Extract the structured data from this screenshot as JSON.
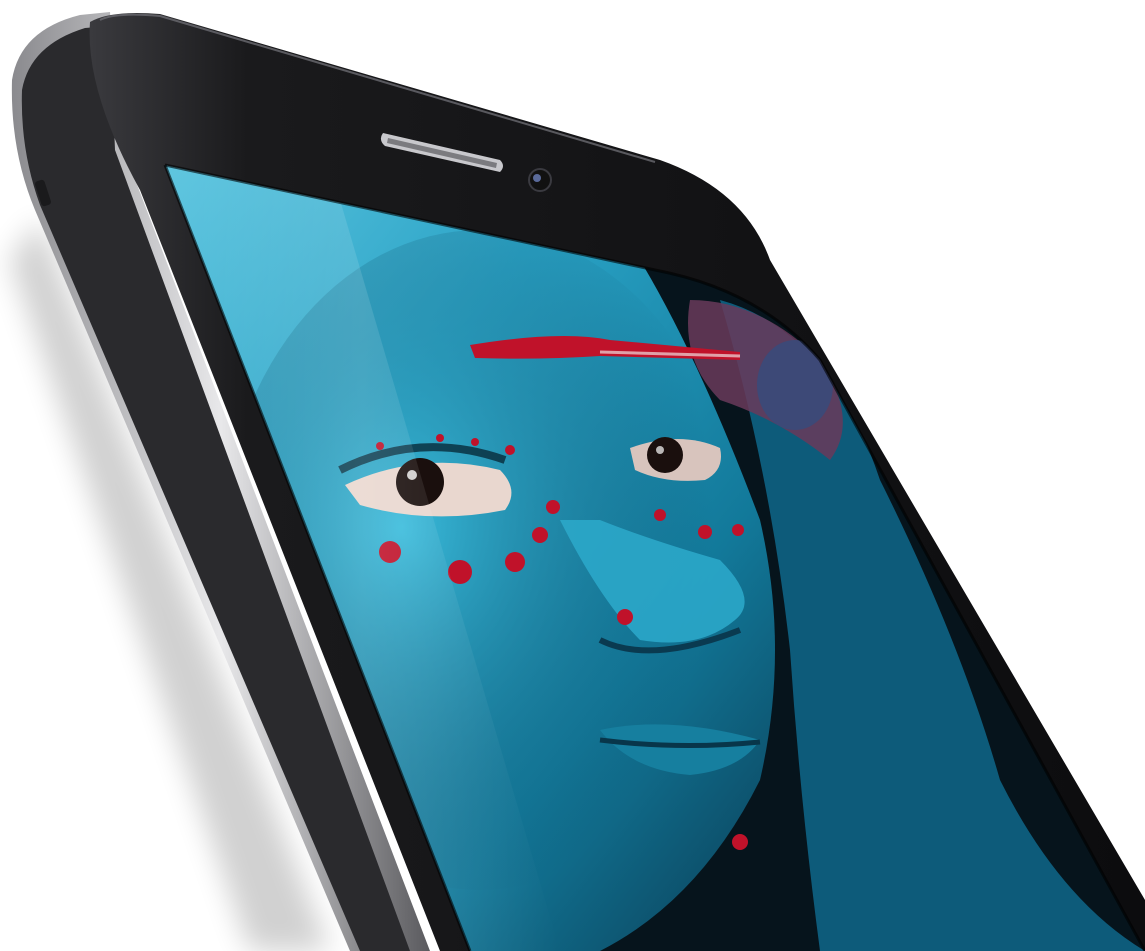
{
  "scene": {
    "subject": "smartphone",
    "background_color": "#ffffff",
    "colors": {
      "frame_dark": "#1c1c1e",
      "frame_edge": "#5a5a5e",
      "bezel": "#0e0e10",
      "face_paint_blue": "#1b8fb0",
      "face_paint_cyan": "#29b5d6",
      "paint_red": "#c0122a",
      "skin_shadow": "#0a2a3a"
    },
    "parts": {
      "earpiece": "speaker-grille-icon",
      "front_camera": "front-camera-icon",
      "side_button": "volume-button-icon"
    }
  }
}
